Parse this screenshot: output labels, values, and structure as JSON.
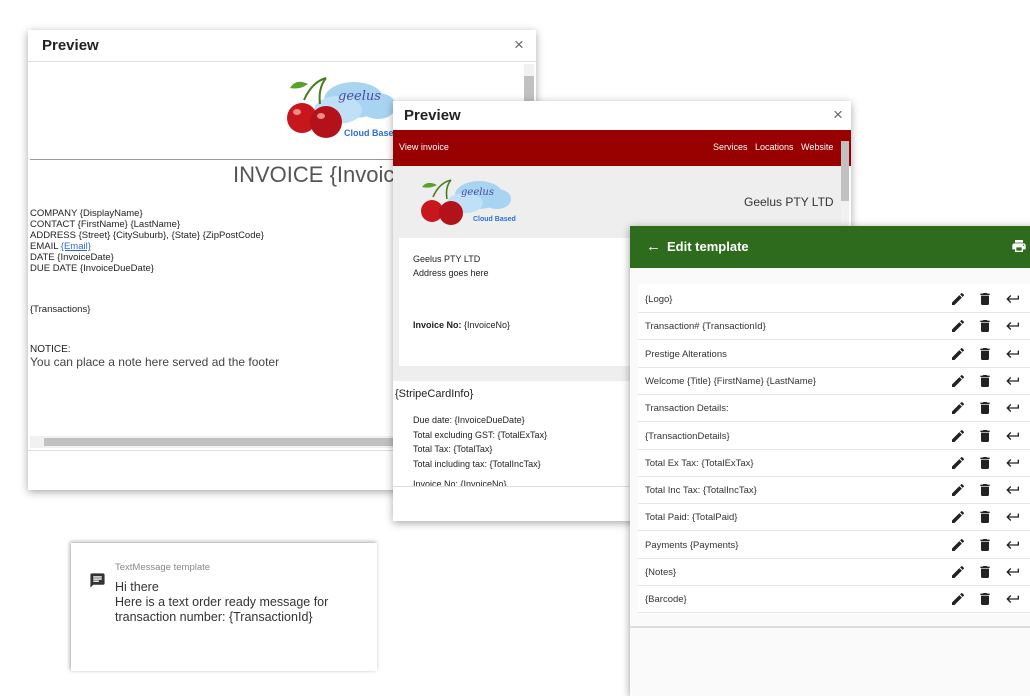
{
  "preview1": {
    "title": "Preview",
    "close": "×",
    "logo_text": "geelus",
    "logo_sub": "Cloud Based",
    "invoice_title": "INVOICE {Invoic",
    "fields": [
      "COMPANY {DisplayName}",
      "CONTACT {FirstName} {LastName}",
      "ADDRESS {Street} {CitySuburb}, {State} {ZipPostCode}",
      "DATE {InvoiceDate}",
      "DUE DATE {InvoiceDueDate}"
    ],
    "email_label": "EMAIL ",
    "email_link": "{Email}",
    "transactions": "{Transactions}",
    "notice_label": "NOTICE:",
    "notice_text": "You can place a note here served ad the footer"
  },
  "preview2": {
    "title": "Preview",
    "close": "×",
    "nav_left": "View invoice",
    "nav_items": [
      "Services",
      "Locations",
      "Website"
    ],
    "logo_text": "geelus",
    "logo_sub": "Cloud Based",
    "company": "Geelus PTY LTD",
    "address_lines": [
      "Geelus PTY LTD",
      "Address goes here"
    ],
    "invoice_no_label": "Invoice No:",
    "invoice_no_value": " {InvoiceNo}",
    "stripe": "{StripeCardInfo}",
    "totals": [
      "Due date: {InvoiceDueDate}",
      "Total excluding GST: {TotalExTax}",
      "Total Tax: {TotalTax}",
      "Total including tax: {TotalIncTax}"
    ],
    "cut_line": "Invoice No: {InvoiceNo}"
  },
  "edit": {
    "title": "Edit template",
    "rows": [
      "{Logo}",
      "Transaction# {TransactionId}",
      "Prestige Alterations",
      "Welcome {Title} {FirstName} {LastName}",
      "Transaction Details:",
      "{TransactionDetails}",
      "Total Ex Tax: {TotalExTax}",
      "Total Inc Tax: {TotalIncTax}",
      "Total Paid: {TotalPaid}",
      "Payments {Payments}",
      "{Notes}",
      "{Barcode}"
    ]
  },
  "sms": {
    "label": "TextMessage template",
    "line1": "Hi there",
    "line2": "Here is a text order ready message for",
    "line3": "transaction number: {TransactionId}"
  },
  "colors": {
    "header_red": "#990000",
    "header_green": "#2e6b1d",
    "logo_blue": "#2d6fd2"
  }
}
